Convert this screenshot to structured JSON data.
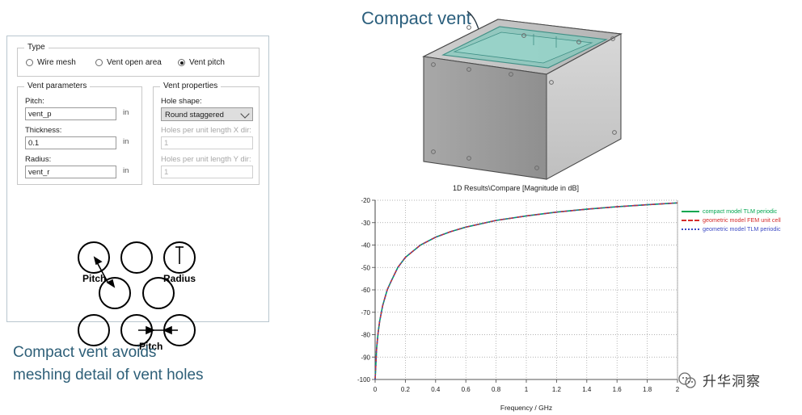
{
  "header": {
    "compact_vent_label": "Compact vent"
  },
  "caption": {
    "line1": "Compact vent avoids",
    "line2": "meshing detail of vent holes"
  },
  "dialog": {
    "type_group": {
      "title": "Type",
      "options": [
        {
          "label": "Wire mesh",
          "selected": false
        },
        {
          "label": "Vent open area",
          "selected": false
        },
        {
          "label": "Vent pitch",
          "selected": true
        }
      ]
    },
    "vent_parameters": {
      "title": "Vent parameters",
      "fields": [
        {
          "label": "Pitch:",
          "value": "vent_p",
          "unit": "in"
        },
        {
          "label": "Thickness:",
          "value": "0.1",
          "unit": "in"
        },
        {
          "label": "Radius:",
          "value": "vent_r",
          "unit": "in"
        }
      ]
    },
    "vent_properties": {
      "title": "Vent properties",
      "hole_shape_label": "Hole shape:",
      "hole_shape_value": "Round staggered",
      "holes_x_label": "Holes per unit length X dir:",
      "holes_x_value": "1",
      "holes_y_label": "Holes per unit length Y dir:",
      "holes_y_value": "1"
    }
  },
  "hole_diagram": {
    "pitch_label_1": "Pitch",
    "pitch_label_2": "Pitch",
    "radius_label": "Radius"
  },
  "watermark": {
    "text": "升华洞察"
  },
  "chart_data": {
    "type": "line",
    "title": "1D Results\\Compare [Magnitude in dB]",
    "xlabel": "Frequency / GHz",
    "ylabel": "",
    "xlim": [
      0,
      2
    ],
    "ylim": [
      -100,
      -20
    ],
    "xticks": [
      0,
      0.2,
      0.4,
      0.6,
      0.8,
      1,
      1.2,
      1.4,
      1.6,
      1.8,
      2
    ],
    "xtick_labels": [
      "0",
      "0.2",
      "0.4",
      "0.6",
      "0.8",
      "1",
      "1.2",
      "1.4",
      "1.6",
      "1.8",
      "2"
    ],
    "yticks": [
      -100,
      -90,
      -80,
      -70,
      -60,
      -50,
      -40,
      -30,
      -20
    ],
    "ytick_labels": [
      "-100",
      "-90",
      "-80",
      "-70",
      "-60",
      "-50",
      "-40",
      "-30",
      "-20"
    ],
    "grid": true,
    "legend_position": "right",
    "x": [
      0,
      0.01,
      0.02,
      0.03,
      0.05,
      0.08,
      0.1,
      0.15,
      0.2,
      0.3,
      0.4,
      0.5,
      0.6,
      0.8,
      1.0,
      1.2,
      1.4,
      1.6,
      1.8,
      2.0
    ],
    "series": [
      {
        "name": "compact model TLM periodic",
        "color": "#00a64f",
        "style": "solid",
        "values": [
          -100,
          -86,
          -79,
          -74,
          -67,
          -60,
          -57,
          -50,
          -45.5,
          -40,
          -36.5,
          -34,
          -32,
          -29,
          -27,
          -25.3,
          -24,
          -22.9,
          -22,
          -21.2
        ]
      },
      {
        "name": "geometric model FEM unit cell",
        "color": "#d42a2a",
        "style": "dashed",
        "values": [
          -100,
          -86,
          -79,
          -74,
          -67,
          -60,
          -57,
          -50,
          -45.5,
          -40,
          -36.5,
          -34,
          -32,
          -29,
          -27,
          -25.3,
          -24,
          -22.9,
          -22,
          -21.2
        ]
      },
      {
        "name": "geometric model TLM periodic",
        "color": "#3b49c4",
        "style": "dotted",
        "values": [
          -100,
          -86,
          -79,
          -74,
          -67,
          -60,
          -57,
          -50,
          -45.5,
          -40,
          -36.5,
          -34,
          -32,
          -29,
          -27,
          -25.3,
          -24,
          -22.9,
          -22,
          -21.2
        ]
      }
    ]
  }
}
